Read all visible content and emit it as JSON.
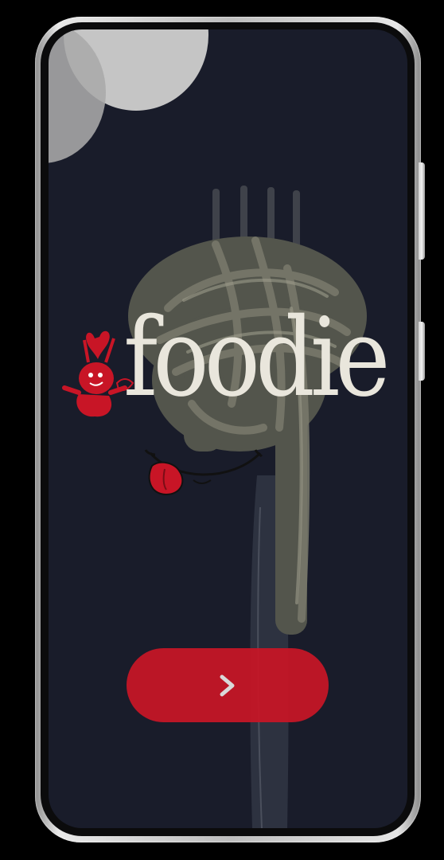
{
  "app": {
    "brand_name": "foodie",
    "colors": {
      "background": "#191c2a",
      "accent_red": "#c81526",
      "logo_text": "#e9e6dc",
      "decor_circle": "#c5c5c5"
    }
  },
  "next_button": {
    "icon": "chevron-right-icon"
  }
}
